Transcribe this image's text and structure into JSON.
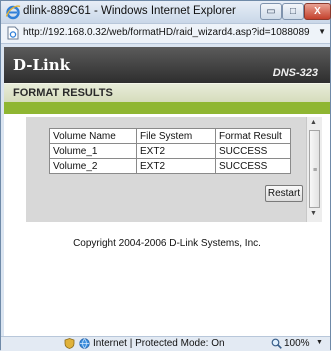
{
  "window": {
    "title": "dlink-889C61 - Windows Internet Explorer",
    "minimize_glyph": "▭",
    "maximize_glyph": "□",
    "close_glyph": "X",
    "address_url": "http://192.168.0.32/web/formatHD/raid_wizard4.asp?id=1088089",
    "address_dropdown_glyph": "▼"
  },
  "header": {
    "logo": "D-Link",
    "model": "DNS-323"
  },
  "page": {
    "title": "FORMAT RESULTS"
  },
  "results_table": {
    "headers": [
      "Volume Name",
      "File System",
      "Format Result"
    ],
    "rows": [
      [
        "Volume_1",
        "EXT2",
        "SUCCESS"
      ],
      [
        "Volume_2",
        "EXT2",
        "SUCCESS"
      ]
    ]
  },
  "restart_label": "Restart",
  "scrollbar": {
    "up_glyph": "▲",
    "grip_glyph": "≡",
    "down_glyph": "▼"
  },
  "copyright": "Copyright 2004-2006 D-Link Systems, Inc.",
  "statusbar": {
    "zone": "Internet | Protected Mode: On",
    "zoom": "100%",
    "zoom_dropdown_glyph": "▼"
  },
  "icons": {
    "browser": "internet-explorer-icon",
    "page": "page-icon",
    "protected_mode": "shield-icon",
    "zone": "globe-icon",
    "zoom": "magnifier-icon"
  },
  "colors": {
    "accent_green": "#8fb632",
    "header_dark": "#2e2e2e",
    "title_band": "#d4dbba"
  }
}
